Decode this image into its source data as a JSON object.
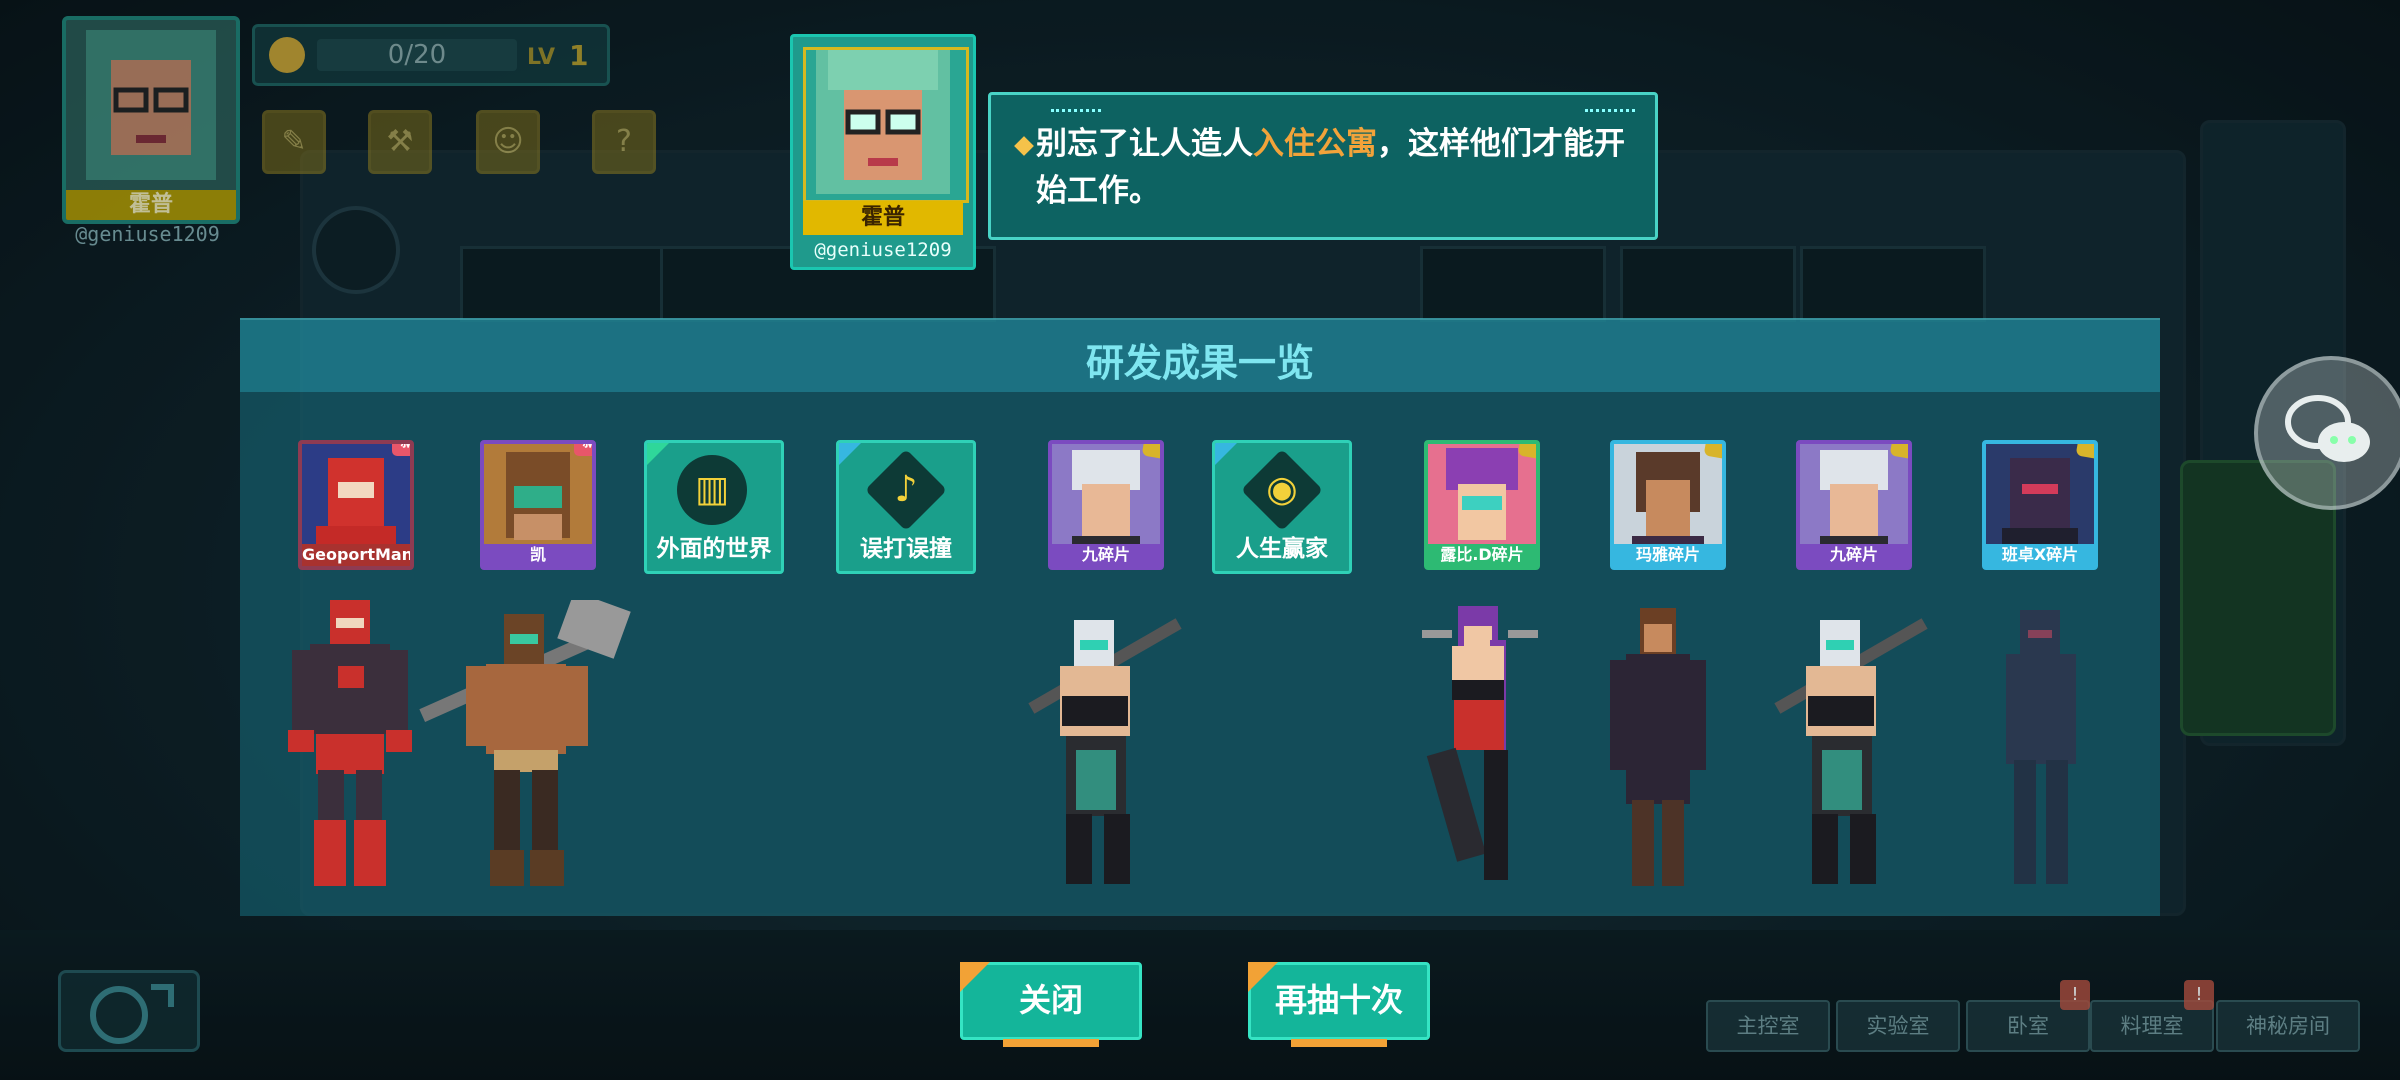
{
  "player": {
    "name": "霍普",
    "handle": "@geniuse1209",
    "mood": "0/20",
    "level_label": "LV",
    "level": "1",
    "buttons": [
      "note-icon",
      "tool-icon",
      "smile-icon",
      "help-icon"
    ]
  },
  "npc": {
    "name": "霍普",
    "handle": "@geniuse1209"
  },
  "dialog": {
    "text_before": "别忘了让人造人",
    "highlight": "入住公寓",
    "text_after": "，这样他们才能开始工作。"
  },
  "panel": {
    "title": "研发成果一览",
    "cards": [
      {
        "kind": "character",
        "label": "GeoportMan",
        "badge": "新"
      },
      {
        "kind": "character",
        "label": "凯",
        "badge": "新"
      },
      {
        "kind": "item",
        "label": "外面的世界",
        "icon": "suitcase-icon"
      },
      {
        "kind": "item",
        "label": "误打误撞",
        "icon": "horn-icon"
      },
      {
        "kind": "fragment",
        "label": "九碎片"
      },
      {
        "kind": "item",
        "label": "人生赢家",
        "icon": "mask-icon"
      },
      {
        "kind": "fragment",
        "label": "露比.D碎片"
      },
      {
        "kind": "fragment",
        "label": "玛雅碎片"
      },
      {
        "kind": "fragment",
        "label": "九碎片"
      },
      {
        "kind": "fragment",
        "label": "班卓X碎片"
      }
    ]
  },
  "buttons": {
    "close": "关闭",
    "draw_ten": "再抽十次"
  },
  "rooms": {
    "main": "主控室",
    "lab": "实验室",
    "bedroom": "卧室",
    "kitchen": "料理室",
    "mystery": "神秘房间",
    "alert": "!"
  },
  "colors": {
    "accent": "#14b59a",
    "highlight": "#f2a33a",
    "gold": "#e1b800",
    "new_badge": "#e8566a"
  }
}
